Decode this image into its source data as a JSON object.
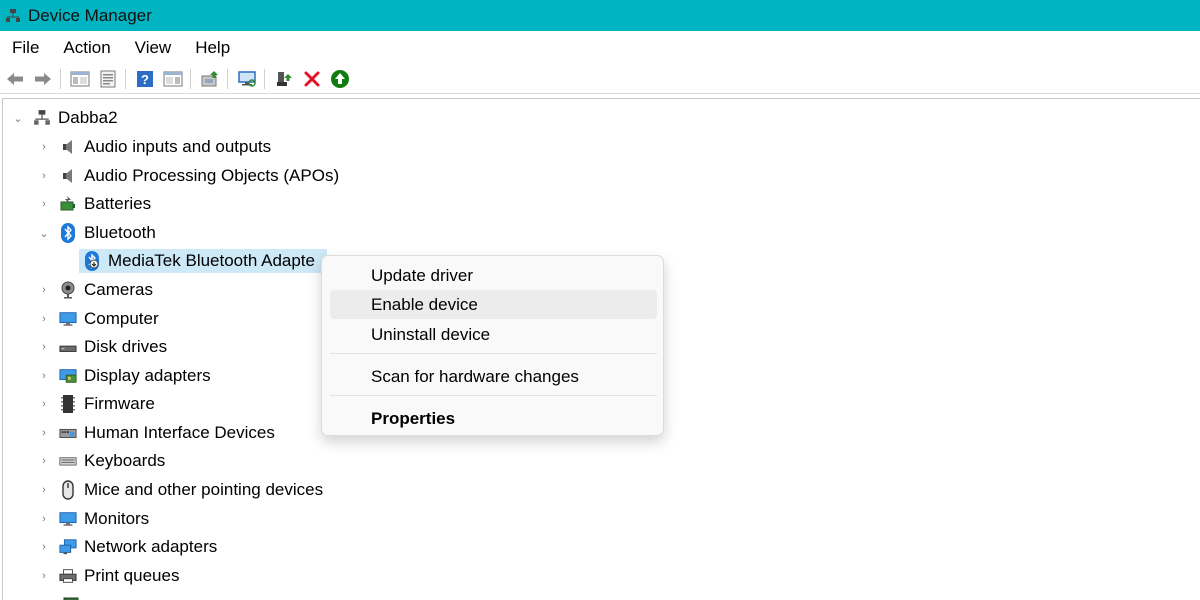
{
  "window": {
    "title": "Device Manager"
  },
  "menubar": {
    "items": [
      "File",
      "Action",
      "View",
      "Help"
    ]
  },
  "toolbar": {
    "buttons": [
      "back-icon",
      "forward-icon",
      "show-hide-console-tree-icon",
      "properties-icon",
      "help-icon",
      "action-pane-icon",
      "update-driver-icon",
      "scan-hardware-icon",
      "add-driver-icon",
      "uninstall-icon",
      "enable-device-icon"
    ],
    "colors": {
      "uninstall": "#e81123",
      "enable": "#107c10"
    }
  },
  "tree": {
    "root": "Dabba2",
    "categories": [
      {
        "label": "Audio inputs and outputs",
        "icon": "speaker-icon"
      },
      {
        "label": "Audio Processing Objects (APOs)",
        "icon": "speaker-icon"
      },
      {
        "label": "Batteries",
        "icon": "battery-icon"
      },
      {
        "label": "Bluetooth",
        "icon": "bluetooth-icon",
        "expanded": true,
        "children": [
          {
            "label": "MediaTek Bluetooth Adapte",
            "icon": "bluetooth-device-disabled-icon",
            "selected": true
          }
        ]
      },
      {
        "label": "Cameras",
        "icon": "camera-icon"
      },
      {
        "label": "Computer",
        "icon": "computer-icon"
      },
      {
        "label": "Disk drives",
        "icon": "disk-drive-icon"
      },
      {
        "label": "Display adapters",
        "icon": "display-adapter-icon"
      },
      {
        "label": "Firmware",
        "icon": "firmware-icon"
      },
      {
        "label": "Human Interface Devices",
        "icon": "hid-icon"
      },
      {
        "label": "Keyboards",
        "icon": "keyboard-icon"
      },
      {
        "label": "Mice and other pointing devices",
        "icon": "mouse-icon"
      },
      {
        "label": "Monitors",
        "icon": "monitor-icon"
      },
      {
        "label": "Network adapters",
        "icon": "network-adapter-icon"
      },
      {
        "label": "Print queues",
        "icon": "printer-icon"
      }
    ]
  },
  "context_menu": {
    "items": [
      {
        "label": "Update driver"
      },
      {
        "label": "Enable device",
        "hovered": true
      },
      {
        "label": "Uninstall device"
      },
      {
        "label": "Scan for hardware changes"
      },
      {
        "label": "Properties",
        "bold": true
      }
    ]
  },
  "colors": {
    "titlebar": "#00b4c2",
    "selection": "#cde8f7",
    "menu_hover": "#ececec"
  }
}
